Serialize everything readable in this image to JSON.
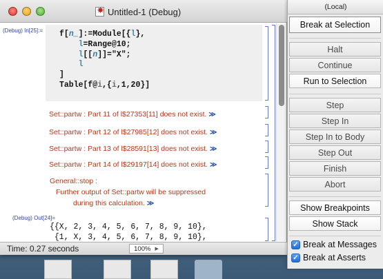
{
  "window": {
    "title": "Untitled-1 (Debug)"
  },
  "notebook": {
    "input_label": "(Debug) In[25]:=",
    "output_label": "(Debug) Out[24]=",
    "messages": [
      "Set::partw :  Part 11 of l$27353[11] does not exist.",
      "Set::partw :  Part 12 of l$27985[12] does not exist.",
      "Set::partw :  Part 13 of l$28591[13] does not exist.",
      "Set::partw :  Part 14 of l$29197[14] does not exist."
    ],
    "more_glyph": "≫",
    "stop_message": {
      "line1": "General::stop :",
      "line2": "Further output of Set::partw will be suppressed",
      "line3": "during this calculation."
    },
    "output_lines": [
      "{{X, 2, 3, 4, 5, 6, 7, 8, 9, 10},",
      " {1, X, 3, 4, 5, 6, 7, 8, 9, 10},"
    ]
  },
  "status": {
    "time": "Time: 0.27 seconds",
    "zoom": "100%"
  },
  "debugger": {
    "title": "(Local)",
    "buttons": {
      "break_at_selection": "Break at Selection",
      "halt": "Halt",
      "continue": "Continue",
      "run_to_selection": "Run to Selection",
      "step": "Step",
      "step_in": "Step In",
      "step_in_to_body": "Step In to Body",
      "step_out": "Step Out",
      "finish": "Finish",
      "abort": "Abort",
      "show_breakpoints": "Show Breakpoints",
      "show_stack": "Show Stack"
    },
    "checkboxes": {
      "break_at_messages": "Break at Messages",
      "break_at_asserts": "Break at Asserts"
    }
  },
  "colors": {
    "message_red": "#b0391c",
    "label_blue": "#33449a",
    "more_link_blue": "#2a53a8",
    "checkbox_blue": "#1f6fd8"
  }
}
